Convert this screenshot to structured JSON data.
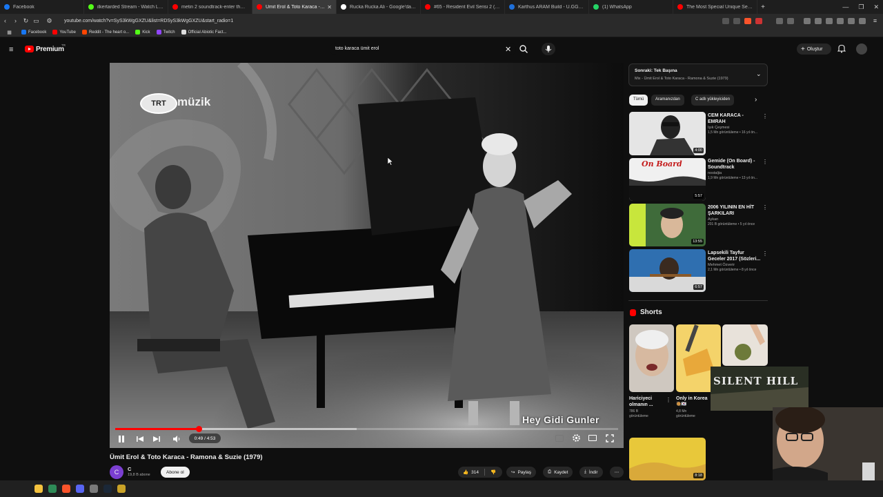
{
  "browser": {
    "tabs": [
      {
        "title": "Facebook",
        "color": "#1877f2"
      },
      {
        "title": "ilkertarded Stream - Watch Live on K",
        "color": "#53fc18"
      },
      {
        "title": "metin 2 soundtrack-enter the east -",
        "color": "#ff0000"
      },
      {
        "title": "Ümit Erol & Toto Karaca - Ra",
        "color": "#ff0000",
        "active": true
      },
      {
        "title": "Rucka Rucka Ali - Google'da Ara",
        "color": "#ffffff"
      },
      {
        "title": "#65 - Resident Evil Serisi 2 (PS2 Döne",
        "color": "#ff0000"
      },
      {
        "title": "Karthus ARAM Build - U.GG Karthus",
        "color": "#1e6fd9"
      },
      {
        "title": "(1) WhatsApp",
        "color": "#25d366"
      },
      {
        "title": "The Most Special Unique Self Heatin",
        "color": "#ff0000"
      }
    ],
    "url": "youtube.com/watch?v=SyS3kWgGXZU&list=RDSyS3kWgGXZU&start_radio=1",
    "bookmarks": [
      "Facebook",
      "YouTube",
      "Reddit - The heart o...",
      "Kick",
      "Twitch",
      "Official Abiotic Fact..."
    ],
    "bookmark_colors": [
      "#1877f2",
      "#ff0000",
      "#ff4500",
      "#53fc18",
      "#9146ff",
      "#dddddd"
    ]
  },
  "youtube": {
    "logo_text": "Premium",
    "logo_sup": "TR",
    "search_value": "toto karaca ümit erol",
    "create_label": "Oluştur"
  },
  "video": {
    "overlay_brand": "müzik",
    "overlay_brand_badge": "TRT",
    "caption": "Hey Gidi Gunler",
    "time": "0:49 / 4:53",
    "progress": 0.167,
    "buffered": 0.48,
    "title": "Ümit Erol & Toto Karaca - Ramona & Suzie (1979)",
    "channel": "C",
    "channel_avatar_letter": "C",
    "subscribers": "19,8 B abone",
    "subscribe_label": "Abone ol",
    "likes": "314",
    "share_label": "Paylaş",
    "save_label": "Kaydet",
    "download_label": "İndir"
  },
  "mix": {
    "header": "Sonraki: Tek Başına",
    "subtitle": "Mix - Ümit Erol & Toto Karaca - Ramona & Suzie (1979)"
  },
  "chips": [
    "Tümü",
    "Aramanızdan",
    "C adlı yükleyiciden"
  ],
  "recommendations": [
    {
      "title": "CEM KARACA - EMRAH",
      "title2": "",
      "channel": "Işık Çeşmesi",
      "meta": "1,5 Mn görüntüleme • 16 yıl ön...",
      "duration": "4:00"
    },
    {
      "title": "Gemide (On Board) -",
      "title2": "Soundtrack",
      "channel": "nostaljia",
      "meta": "1,9 Mn görüntüleme • 13 yıl ön...",
      "duration": "5:57"
    },
    {
      "title": "2006 YILININ EN HİT",
      "title2": "ŞARKILARI",
      "channel": "Aykan",
      "meta": "201 B görüntüleme • 5 yıl önce",
      "duration": "13:55"
    },
    {
      "title": "Lapsekili Tayfur",
      "title2": "Geceler 2017 (Sözleri...",
      "channel": "Mehmet Özverir",
      "meta": "2,1 Mn görüntüleme • 8 yıl önce",
      "duration": "6:57"
    }
  ],
  "thumb_overlay": "On Board",
  "shorts": {
    "heading": "Shorts",
    "items": [
      {
        "title": "Hariciyeci",
        "title2": "olmanın ...",
        "meta": "786 B",
        "meta2": "görüntüleme"
      },
      {
        "title": "Only in Korea",
        "title2": "🥘🇰🇷",
        "meta": "4,8 Mn",
        "meta2": "görüntüleme"
      }
    ]
  },
  "next_duration": "8:18",
  "webcam_overlay_text": "SILENT HILL",
  "colors": {
    "accent": "#ff0000",
    "bg": "#0f0f0f",
    "chip": "#272727"
  }
}
